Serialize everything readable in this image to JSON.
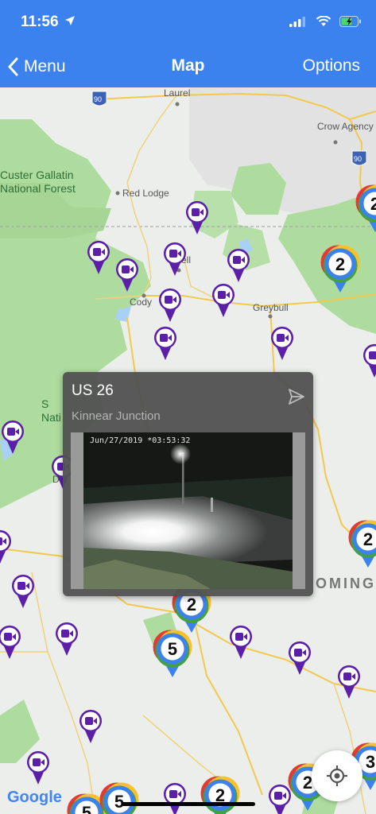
{
  "status_bar": {
    "time": "11:56"
  },
  "nav": {
    "back_label": "Menu",
    "title": "Map",
    "options_label": "Options"
  },
  "map_labels": {
    "laurel": "Laurel",
    "crow_agency": "Crow Agency",
    "red_lodge": "Red Lodge",
    "custer_gallatin": "Custer Gallatin\nNational Forest",
    "well": "ell",
    "cody": "Cody",
    "greybull": "Greybull",
    "shoshone_fragment": "S\nNati",
    "d_fragment": "D",
    "wyoming": "OMING",
    "interstate_90a": "90",
    "interstate_90b": "90"
  },
  "clusters": [
    {
      "count": "2"
    },
    {
      "count": "2"
    },
    {
      "count": "2"
    },
    {
      "count": "2"
    },
    {
      "count": "5"
    },
    {
      "count": "5"
    },
    {
      "count": "5"
    },
    {
      "count": "2"
    },
    {
      "count": "2"
    },
    {
      "count": "3"
    }
  ],
  "popup": {
    "title": "US 26",
    "subtitle": "Kinnear Junction",
    "camera_timestamp": "Jun/27/2019 *03:53:32"
  },
  "map_footer": {
    "google": "Google"
  },
  "colors": {
    "nav_bg": "#3b82ef",
    "camera_pin": "#5b1fa8",
    "water": "#a9d0f5",
    "forest": "#aedc9f"
  },
  "icons": [
    "location-arrow-icon",
    "signal-icon",
    "wifi-icon",
    "battery-icon",
    "chevron-left-icon",
    "camera-pin-icon",
    "share-icon",
    "locate-icon"
  ]
}
